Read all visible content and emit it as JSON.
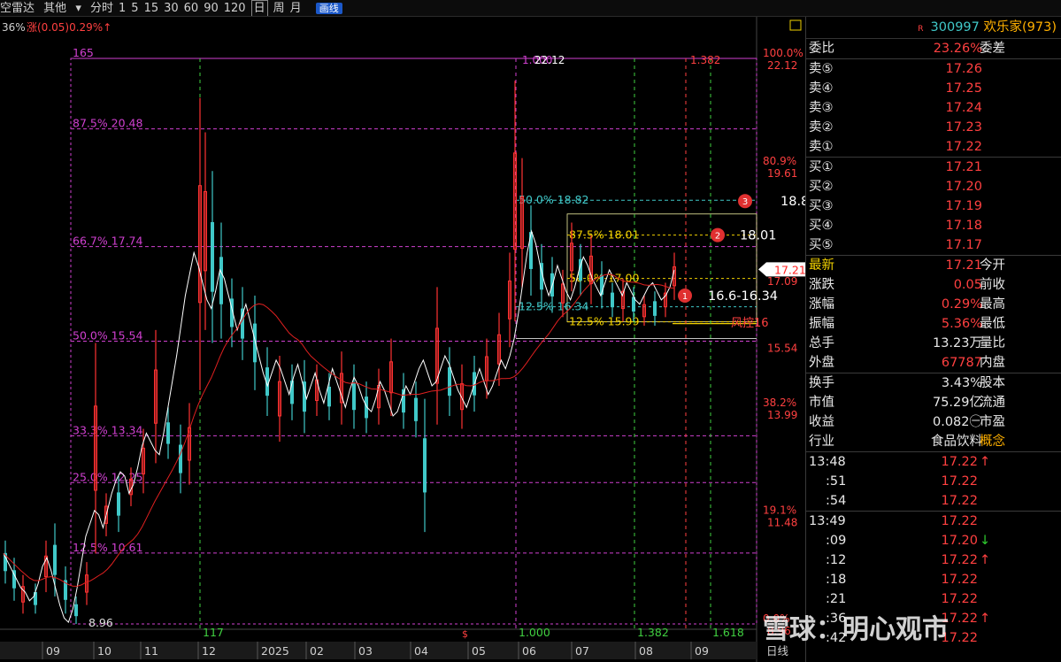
{
  "toolbar": {
    "prefix": "空雷达",
    "menu": "其他",
    "menu_arrow": "▾",
    "periods": [
      "分时",
      "1",
      "5",
      "15",
      "30",
      "60",
      "90",
      "120",
      "日",
      "周",
      "月"
    ],
    "active_period": "日",
    "draw_button": "画线"
  },
  "status_line": {
    "left": "36%",
    "change": "涨(0.05)0.29%↑"
  },
  "chart_data": {
    "type": "candlestick",
    "x_axis_labels": [
      "09",
      "10",
      "11",
      "12",
      "2025",
      "02",
      "03",
      "04",
      "05",
      "06",
      "07",
      "08",
      "09"
    ],
    "x_axis_right_label": "日线",
    "price_axis_labels": [
      "22.12",
      "19.61",
      "17.09",
      "15.54",
      "13.99",
      "11.48",
      "8.96"
    ],
    "percent_axis_labels": [
      "100.0%",
      "80.9%",
      "38.2%",
      "19.1%",
      "0.0%"
    ],
    "current_price_tag": "17.21",
    "ylim": [
      8.96,
      22.12
    ],
    "fib_levels_left": [
      {
        "label": "165",
        "value": 22.12
      },
      {
        "label": "87.5% 20.48",
        "value": 20.48
      },
      {
        "label": "66.7% 17.74",
        "value": 17.74
      },
      {
        "label": "50.0% 15.54",
        "value": 15.54
      },
      {
        "label": "33.3% 13.34",
        "value": 13.34
      },
      {
        "label": "25.0% 12.25",
        "value": 12.25
      },
      {
        "label": "12.5% 10.61",
        "value": 10.61
      }
    ],
    "fib_levels_right": [
      {
        "label": "50.0% 18.82",
        "value": 18.82
      },
      {
        "label": "87.5% 18.01",
        "value": 18.01
      },
      {
        "label": "50.0% 17.00",
        "value": 17.0
      },
      {
        "label": "12.5% 16.34",
        "value": 16.34
      },
      {
        "label": "12.5% 15.99",
        "value": 15.99
      }
    ],
    "low_label": "8.96",
    "high_label": "22.12",
    "top_marks": [
      "1.000",
      "1.382"
    ],
    "bottom_marks": [
      "117",
      "1.000",
      "1.382",
      "1.618"
    ],
    "annotations": [
      {
        "num": "3",
        "text": "18.8",
        "value": 18.8
      },
      {
        "num": "2",
        "text": "18.01",
        "value": 18.01
      },
      {
        "num": "1",
        "text": "16.6-16.34",
        "value": 16.6
      }
    ],
    "risk_label": "风控16",
    "risk_value": 16.0,
    "close_series": [
      10.6,
      10.4,
      10.2,
      10.0,
      9.8,
      9.7,
      9.5,
      9.6,
      9.9,
      10.3,
      10.5,
      10.2,
      9.8,
      9.4,
      9.1,
      9.0,
      9.3,
      9.8,
      10.4,
      11.0,
      11.3,
      11.6,
      11.5,
      11.2,
      11.6,
      12.0,
      12.3,
      12.5,
      12.4,
      12.0,
      12.2,
      12.6,
      13.1,
      13.4,
      13.2,
      13.0,
      12.9,
      13.4,
      14.0,
      14.6,
      15.2,
      15.9,
      16.6,
      17.1,
      17.6,
      17.3,
      16.9,
      16.5,
      16.3,
      16.7,
      17.2,
      17.0,
      16.6,
      16.2,
      15.8,
      16.1,
      16.4,
      16.0,
      15.6,
      15.2,
      14.8,
      14.5,
      14.8,
      15.1,
      14.9,
      14.6,
      14.3,
      14.7,
      15.0,
      14.6,
      14.2,
      14.5,
      14.8,
      14.4,
      14.1,
      14.5,
      14.9,
      14.6,
      14.3,
      14.0,
      14.4,
      14.7,
      14.5,
      14.2,
      14.0,
      13.9,
      14.2,
      14.6,
      14.4,
      14.1,
      13.8,
      13.9,
      14.2,
      14.5,
      14.3,
      14.6,
      14.9,
      15.1,
      14.8,
      14.5,
      14.6,
      14.9,
      15.2,
      15.0,
      14.7,
      14.4,
      14.2,
      14.0,
      14.3,
      14.6,
      14.9,
      14.6,
      14.3,
      14.5,
      14.8,
      15.1,
      14.9,
      15.2,
      15.6,
      16.2,
      16.9,
      17.6,
      18.1,
      17.8,
      17.3,
      16.9,
      16.6,
      16.9,
      17.3,
      17.0,
      16.7,
      16.5,
      16.8,
      17.2,
      17.5,
      17.3,
      17.0,
      16.8,
      16.6,
      16.9,
      17.2,
      17.0,
      16.8,
      16.6,
      16.9,
      16.7,
      16.5,
      16.4,
      16.6,
      16.8,
      16.9,
      16.7,
      16.5,
      16.6,
      16.8,
      17.2
    ],
    "candles": [
      {
        "x": 6,
        "h": 10.9,
        "l": 9.9,
        "up": false
      },
      {
        "x": 16,
        "h": 10.5,
        "l": 9.5,
        "up": false
      },
      {
        "x": 26,
        "h": 10.1,
        "l": 9.2,
        "up": true
      },
      {
        "x": 40,
        "h": 9.9,
        "l": 9.2,
        "up": false
      },
      {
        "x": 52,
        "h": 10.9,
        "l": 9.7,
        "up": true
      },
      {
        "x": 62,
        "h": 11.3,
        "l": 9.6,
        "up": false
      },
      {
        "x": 74,
        "h": 10.3,
        "l": 9.2,
        "up": false
      },
      {
        "x": 86,
        "h": 9.6,
        "l": 8.96,
        "up": false
      },
      {
        "x": 98,
        "h": 10.4,
        "l": 9.4,
        "up": true
      },
      {
        "x": 108,
        "h": 15.5,
        "l": 10.6,
        "up": true
      },
      {
        "x": 120,
        "h": 12.0,
        "l": 11.0,
        "up": true
      },
      {
        "x": 134,
        "h": 12.4,
        "l": 11.1,
        "up": false
      },
      {
        "x": 148,
        "h": 12.6,
        "l": 11.7,
        "up": true
      },
      {
        "x": 162,
        "h": 13.5,
        "l": 12.0,
        "up": true
      },
      {
        "x": 176,
        "h": 15.8,
        "l": 12.7,
        "up": true
      },
      {
        "x": 190,
        "h": 14.0,
        "l": 12.8,
        "up": false
      },
      {
        "x": 204,
        "h": 13.6,
        "l": 12.0,
        "up": false
      },
      {
        "x": 214,
        "h": 14.1,
        "l": 12.2,
        "up": true
      },
      {
        "x": 226,
        "h": 21.2,
        "l": 14.4,
        "up": true
      },
      {
        "x": 232,
        "h": 20.4,
        "l": 15.8,
        "up": true
      },
      {
        "x": 240,
        "h": 19.5,
        "l": 15.5,
        "up": false
      },
      {
        "x": 250,
        "h": 18.3,
        "l": 15.6,
        "up": false
      },
      {
        "x": 262,
        "h": 17.0,
        "l": 15.4,
        "up": false
      },
      {
        "x": 274,
        "h": 16.8,
        "l": 15.1,
        "up": false
      },
      {
        "x": 288,
        "h": 16.6,
        "l": 14.4,
        "up": false
      },
      {
        "x": 302,
        "h": 15.4,
        "l": 13.8,
        "up": false
      },
      {
        "x": 316,
        "h": 15.2,
        "l": 13.2,
        "up": true
      },
      {
        "x": 330,
        "h": 15.0,
        "l": 13.7,
        "up": false
      },
      {
        "x": 344,
        "h": 15.1,
        "l": 13.4,
        "up": false
      },
      {
        "x": 358,
        "h": 15.0,
        "l": 13.8,
        "up": true
      },
      {
        "x": 372,
        "h": 14.8,
        "l": 13.7,
        "up": false
      },
      {
        "x": 386,
        "h": 15.3,
        "l": 13.6,
        "up": true
      },
      {
        "x": 400,
        "h": 15.0,
        "l": 13.5,
        "up": false
      },
      {
        "x": 414,
        "h": 14.6,
        "l": 13.4,
        "up": false
      },
      {
        "x": 428,
        "h": 14.9,
        "l": 13.6,
        "up": true
      },
      {
        "x": 442,
        "h": 15.6,
        "l": 13.8,
        "up": true
      },
      {
        "x": 456,
        "h": 14.8,
        "l": 13.5,
        "up": false
      },
      {
        "x": 470,
        "h": 14.6,
        "l": 13.3,
        "up": false
      },
      {
        "x": 480,
        "h": 14.2,
        "l": 11.1,
        "up": false
      },
      {
        "x": 494,
        "h": 16.8,
        "l": 13.6,
        "up": true
      },
      {
        "x": 508,
        "h": 15.4,
        "l": 13.8,
        "up": false
      },
      {
        "x": 522,
        "h": 15.0,
        "l": 13.5,
        "up": true
      },
      {
        "x": 536,
        "h": 15.2,
        "l": 13.9,
        "up": false
      },
      {
        "x": 550,
        "h": 15.6,
        "l": 14.2,
        "up": true
      },
      {
        "x": 564,
        "h": 16.2,
        "l": 14.5,
        "up": true
      },
      {
        "x": 576,
        "h": 17.6,
        "l": 15.4,
        "up": true
      },
      {
        "x": 582,
        "h": 21.6,
        "l": 16.0,
        "up": true
      },
      {
        "x": 590,
        "h": 19.8,
        "l": 16.8,
        "up": true
      },
      {
        "x": 600,
        "h": 18.7,
        "l": 16.6,
        "up": false
      },
      {
        "x": 612,
        "h": 17.8,
        "l": 16.3,
        "up": false
      },
      {
        "x": 624,
        "h": 17.5,
        "l": 16.2,
        "up": false
      },
      {
        "x": 636,
        "h": 17.2,
        "l": 16.1,
        "up": true
      },
      {
        "x": 646,
        "h": 18.3,
        "l": 16.7,
        "up": true
      },
      {
        "x": 656,
        "h": 17.8,
        "l": 16.6,
        "up": false
      },
      {
        "x": 668,
        "h": 18.0,
        "l": 16.4,
        "up": true
      },
      {
        "x": 680,
        "h": 17.4,
        "l": 16.3,
        "up": false
      },
      {
        "x": 692,
        "h": 16.9,
        "l": 16.1,
        "up": false
      },
      {
        "x": 704,
        "h": 17.0,
        "l": 16.0,
        "up": true
      },
      {
        "x": 716,
        "h": 16.8,
        "l": 16.0,
        "up": false
      },
      {
        "x": 728,
        "h": 16.6,
        "l": 15.9,
        "up": true
      },
      {
        "x": 740,
        "h": 16.7,
        "l": 15.9,
        "up": false
      },
      {
        "x": 752,
        "h": 16.9,
        "l": 16.1,
        "up": true
      },
      {
        "x": 762,
        "h": 17.6,
        "l": 16.5,
        "up": true
      }
    ]
  },
  "quote": {
    "code": "300997",
    "name": "欢乐家(973)",
    "r_mark": "R",
    "weibi": {
      "label": "委比",
      "value": "23.26%",
      "label2": "委差"
    },
    "sell": [
      {
        "label": "卖⑤",
        "price": "17.26"
      },
      {
        "label": "卖④",
        "price": "17.25"
      },
      {
        "label": "卖③",
        "price": "17.24"
      },
      {
        "label": "卖②",
        "price": "17.23"
      },
      {
        "label": "卖①",
        "price": "17.22"
      }
    ],
    "buy": [
      {
        "label": "买①",
        "price": "17.21"
      },
      {
        "label": "买②",
        "price": "17.20"
      },
      {
        "label": "买③",
        "price": "17.19"
      },
      {
        "label": "买④",
        "price": "17.18"
      },
      {
        "label": "买⑤",
        "price": "17.17"
      }
    ],
    "stats1": [
      {
        "label": "最新",
        "value": "17.21",
        "label2": "今开"
      },
      {
        "label": "涨跌",
        "value": "0.05",
        "label2": "前收"
      },
      {
        "label": "涨幅",
        "value": "0.29%",
        "label2": "最高"
      },
      {
        "label": "振幅",
        "value": "5.36%",
        "label2": "最低"
      },
      {
        "label": "总手",
        "value": "13.23万",
        "label2": "量比"
      },
      {
        "label": "外盘",
        "value": "67787",
        "label2": "内盘"
      }
    ],
    "stats2": [
      {
        "label": "换手",
        "value": "3.43%",
        "label2": "股本"
      },
      {
        "label": "市值",
        "value": "75.29亿",
        "label2": "流通"
      },
      {
        "label": "收益",
        "value": "0.082㊀",
        "label2": "市盈"
      },
      {
        "label": "行业",
        "value": "食品饮料",
        "label2": "概念"
      }
    ],
    "ticks": [
      {
        "time": "13:48",
        "price": "17.22",
        "arrow": "↑"
      },
      {
        "time": ":51",
        "price": "17.22",
        "arrow": ""
      },
      {
        "time": ":54",
        "price": "17.22",
        "arrow": ""
      },
      {
        "time": "13:49",
        "price": "17.22",
        "arrow": ""
      },
      {
        "time": ":09",
        "price": "17.20",
        "arrow": "↓"
      },
      {
        "time": ":12",
        "price": "17.22",
        "arrow": "↑"
      },
      {
        "time": ":18",
        "price": "17.22",
        "arrow": ""
      },
      {
        "time": ":21",
        "price": "17.22",
        "arrow": ""
      },
      {
        "time": ":36",
        "price": "17.22",
        "arrow": "↑"
      },
      {
        "time": ":42",
        "price": "17.22",
        "arrow": ""
      }
    ]
  },
  "watermark": "雪球：明心观市",
  "colors": {
    "up": "#ff3232",
    "down": "#40c8c8",
    "fib": "#d040d0",
    "ma": "#e02020",
    "grid": "#3a3a3a"
  }
}
